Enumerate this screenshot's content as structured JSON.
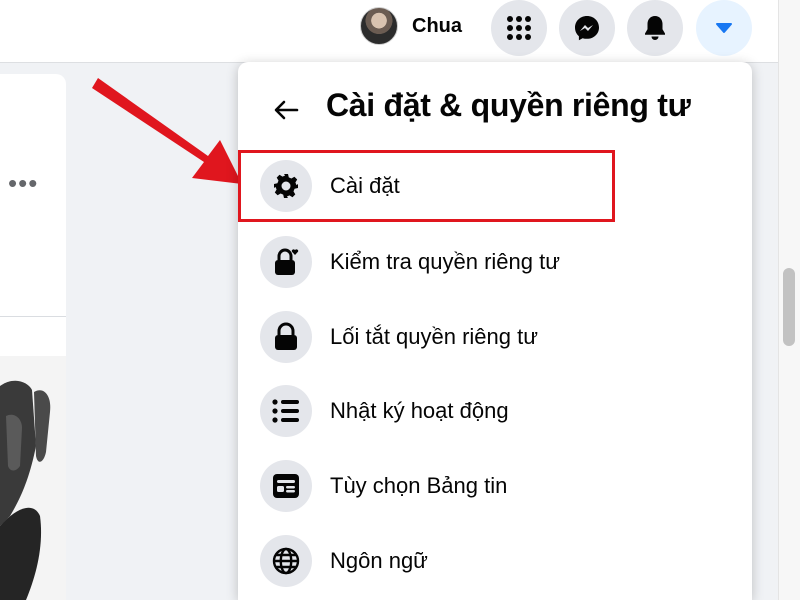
{
  "topbar": {
    "profile_name": "Chua",
    "buttons": [
      "menu-grid-icon",
      "messenger-icon",
      "notifications-bell-icon",
      "account-caret-icon"
    ]
  },
  "menu": {
    "title": "Cài đặt & quyền riêng tư",
    "items": [
      {
        "label": "Cài đặt",
        "icon": "gear-icon"
      },
      {
        "label": "Kiểm tra quyền riêng tư",
        "icon": "lock-heart-icon"
      },
      {
        "label": "Lối tắt quyền riêng tư",
        "icon": "lock-icon"
      },
      {
        "label": "Nhật ký hoạt động",
        "icon": "list-icon"
      },
      {
        "label": "Tùy chọn Bảng tin",
        "icon": "news-feed-icon"
      },
      {
        "label": "Ngôn ngữ",
        "icon": "globe-icon"
      }
    ]
  },
  "colors": {
    "accent": "#1877f2",
    "highlight": "#e0161e",
    "icon_bg": "#e4e6eb"
  }
}
